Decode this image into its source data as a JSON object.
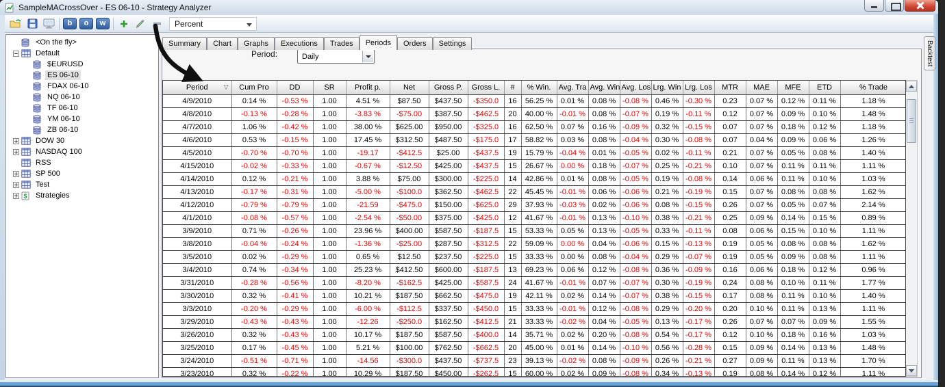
{
  "window": {
    "title": "SampleMACrossOver - ES 06-10 - Strategy Analyzer"
  },
  "toolbar": {
    "letter_buttons": [
      "b",
      "o",
      "w"
    ],
    "display_mode": "Percent"
  },
  "sidebar": {
    "items": [
      {
        "label": "<On the fly>",
        "level": 0,
        "expander": null,
        "icon": "database",
        "selected": false
      },
      {
        "label": "Default",
        "level": 0,
        "expander": "minus",
        "icon": "instrument-list",
        "selected": false
      },
      {
        "label": "$EURUSD",
        "level": 1,
        "expander": null,
        "icon": "database",
        "selected": false
      },
      {
        "label": "ES 06-10",
        "level": 1,
        "expander": null,
        "icon": "database",
        "selected": true
      },
      {
        "label": "FDAX 06-10",
        "level": 1,
        "expander": null,
        "icon": "database",
        "selected": false
      },
      {
        "label": "NQ 06-10",
        "level": 1,
        "expander": null,
        "icon": "database",
        "selected": false
      },
      {
        "label": "TF 06-10",
        "level": 1,
        "expander": null,
        "icon": "database",
        "selected": false
      },
      {
        "label": "YM 06-10",
        "level": 1,
        "expander": null,
        "icon": "database",
        "selected": false
      },
      {
        "label": "ZB 06-10",
        "level": 1,
        "expander": null,
        "icon": "database",
        "selected": false
      },
      {
        "label": "DOW 30",
        "level": 0,
        "expander": "plus",
        "icon": "instrument-list",
        "selected": false
      },
      {
        "label": "NASDAQ 100",
        "level": 0,
        "expander": "plus",
        "icon": "instrument-list",
        "selected": false
      },
      {
        "label": "RSS",
        "level": 0,
        "expander": null,
        "icon": "instrument-list",
        "selected": false
      },
      {
        "label": "SP 500",
        "level": 0,
        "expander": "plus",
        "icon": "instrument-list",
        "selected": false
      },
      {
        "label": "Test",
        "level": 0,
        "expander": "plus",
        "icon": "instrument-list",
        "selected": false
      },
      {
        "label": "Strategies",
        "level": 0,
        "expander": "plus",
        "icon": "strategies",
        "selected": false
      }
    ]
  },
  "tabs": {
    "items": [
      "Summary",
      "Chart",
      "Graphs",
      "Executions",
      "Trades",
      "Periods",
      "Orders",
      "Settings"
    ],
    "active": "Periods"
  },
  "period_selector": {
    "label": "Period:",
    "value": "Daily"
  },
  "side_tab": "Backtest",
  "icons": {
    "sort_glyph": "▽",
    "strategies_glyph": "$"
  },
  "grid": {
    "columns": [
      "Period",
      "Cum Pro",
      "DD",
      "SR",
      "Profit p.",
      "Net",
      "Gross P.",
      "Gross L.",
      "#",
      "% Win.",
      "Avg. Tra",
      "Avg. Win",
      "Avg. Los",
      "Lrg. Win",
      "Lrg. Los",
      "MTR",
      "MAE",
      "MFE",
      "ETD",
      "% Trade"
    ],
    "sort": {
      "column": "Period",
      "direction": "desc"
    },
    "red_cells": [
      [
        5,
        10
      ],
      [
        11,
        10
      ]
    ],
    "rows": [
      [
        "4/9/2010",
        "0.14 %",
        "-0.53 %",
        "1.00",
        "4.51 %",
        "$87.50",
        "$437.50",
        "-$350.0",
        "16",
        "56.25 %",
        "0.01 %",
        "0.08 %",
        "-0.08 %",
        "0.46 %",
        "-0.30 %",
        "0.23",
        "0.07 %",
        "0.12 %",
        "0.11 %",
        "1.18 %"
      ],
      [
        "4/8/2010",
        "-0.13 %",
        "-0.28 %",
        "1.00",
        "-3.83 %",
        "-$75.00",
        "$387.50",
        "-$462.5",
        "20",
        "40.00 %",
        "-0.01 %",
        "0.08 %",
        "-0.07 %",
        "0.19 %",
        "-0.11 %",
        "0.12",
        "0.07 %",
        "0.09 %",
        "0.10 %",
        "1.48 %"
      ],
      [
        "4/7/2010",
        "1.06 %",
        "-0.42 %",
        "1.00",
        "38.00 %",
        "$625.00",
        "$950.00",
        "-$325.0",
        "16",
        "62.50 %",
        "0.07 %",
        "0.16 %",
        "-0.09 %",
        "0.32 %",
        "-0.15 %",
        "0.07",
        "0.07 %",
        "0.18 %",
        "0.12 %",
        "1.18 %"
      ],
      [
        "4/6/2010",
        "0.53 %",
        "-0.15 %",
        "1.00",
        "17.45 %",
        "$312.50",
        "$487.50",
        "-$175.0",
        "17",
        "58.82 %",
        "0.03 %",
        "0.08 %",
        "-0.04 %",
        "0.30 %",
        "-0.08 %",
        "0.07",
        "0.04 %",
        "0.09 %",
        "0.06 %",
        "1.26 %"
      ],
      [
        "4/5/2010",
        "-0.70 %",
        "-0.70 %",
        "1.00",
        "-19.17",
        "-$412.5",
        "$25.00",
        "-$437.5",
        "19",
        "15.79 %",
        "-0.04 %",
        "0.01 %",
        "-0.05 %",
        "0.02 %",
        "-0.11 %",
        "0.21",
        "0.07 %",
        "0.05 %",
        "0.08 %",
        "1.40 %"
      ],
      [
        "4/15/2010",
        "-0.02 %",
        "-0.33 %",
        "1.00",
        "-0.67 %",
        "-$12.50",
        "$425.00",
        "-$437.5",
        "15",
        "26.67 %",
        "0.00 %",
        "0.18 %",
        "-0.07 %",
        "0.25 %",
        "-0.21 %",
        "0.10",
        "0.07 %",
        "0.11 %",
        "0.11 %",
        "1.11 %"
      ],
      [
        "4/14/2010",
        "0.12 %",
        "-0.21 %",
        "1.00",
        "3.88 %",
        "$75.00",
        "$300.00",
        "-$225.0",
        "14",
        "42.86 %",
        "0.01 %",
        "0.08 %",
        "-0.05 %",
        "0.19 %",
        "-0.08 %",
        "0.14",
        "0.06 %",
        "0.11 %",
        "0.10 %",
        "1.03 %"
      ],
      [
        "4/13/2010",
        "-0.17 %",
        "-0.31 %",
        "1.00",
        "-5.00 %",
        "-$100.0",
        "$362.50",
        "-$462.5",
        "22",
        "45.45 %",
        "-0.01 %",
        "0.06 %",
        "-0.06 %",
        "0.21 %",
        "-0.19 %",
        "0.15",
        "0.07 %",
        "0.08 %",
        "0.08 %",
        "1.62 %"
      ],
      [
        "4/12/2010",
        "-0.79 %",
        "-0.79 %",
        "1.00",
        "-21.59",
        "-$475.0",
        "$150.00",
        "-$625.0",
        "29",
        "37.93 %",
        "-0.03 %",
        "0.02 %",
        "-0.06 %",
        "0.08 %",
        "-0.15 %",
        "0.26",
        "0.07 %",
        "0.05 %",
        "0.07 %",
        "2.14 %"
      ],
      [
        "4/1/2010",
        "-0.08 %",
        "-0.57 %",
        "1.00",
        "-2.54 %",
        "-$50.00",
        "$375.00",
        "-$425.0",
        "12",
        "41.67 %",
        "-0.01 %",
        "0.13 %",
        "-0.10 %",
        "0.38 %",
        "-0.21 %",
        "0.25",
        "0.09 %",
        "0.14 %",
        "0.15 %",
        "0.89 %"
      ],
      [
        "3/9/2010",
        "0.71 %",
        "-0.26 %",
        "1.00",
        "23.96 %",
        "$400.00",
        "$587.50",
        "-$187.5",
        "15",
        "53.33 %",
        "0.05 %",
        "0.13 %",
        "-0.05 %",
        "0.33 %",
        "-0.11 %",
        "0.08",
        "0.06 %",
        "0.15 %",
        "0.10 %",
        "1.11 %"
      ],
      [
        "3/8/2010",
        "-0.04 %",
        "-0.24 %",
        "1.00",
        "-1.36 %",
        "-$25.00",
        "$287.50",
        "-$312.5",
        "22",
        "59.09 %",
        "0.00 %",
        "0.04 %",
        "-0.06 %",
        "0.15 %",
        "-0.13 %",
        "0.19",
        "0.05 %",
        "0.08 %",
        "0.08 %",
        "1.62 %"
      ],
      [
        "3/5/2010",
        "0.02 %",
        "-0.29 %",
        "1.00",
        "0.65 %",
        "$12.50",
        "$237.50",
        "-$225.0",
        "15",
        "33.33 %",
        "0.00 %",
        "0.08 %",
        "-0.04 %",
        "0.29 %",
        "-0.07 %",
        "0.19",
        "0.05 %",
        "0.09 %",
        "0.08 %",
        "1.11 %"
      ],
      [
        "3/4/2010",
        "0.74 %",
        "-0.34 %",
        "1.00",
        "25.23 %",
        "$412.50",
        "$600.00",
        "-$187.5",
        "13",
        "69.23 %",
        "0.06 %",
        "0.12 %",
        "-0.08 %",
        "0.36 %",
        "-0.09 %",
        "0.16",
        "0.06 %",
        "0.18 %",
        "0.12 %",
        "0.96 %"
      ],
      [
        "3/31/2010",
        "-0.28 %",
        "-0.56 %",
        "1.00",
        "-8.20 %",
        "-$162.5",
        "$425.00",
        "-$587.5",
        "24",
        "41.67 %",
        "-0.01 %",
        "0.07 %",
        "-0.07 %",
        "0.30 %",
        "-0.19 %",
        "0.24",
        "0.08 %",
        "0.10 %",
        "0.11 %",
        "1.77 %"
      ],
      [
        "3/30/2010",
        "0.32 %",
        "-0.41 %",
        "1.00",
        "10.21 %",
        "$187.50",
        "$662.50",
        "-$475.0",
        "19",
        "42.11 %",
        "0.02 %",
        "0.14 %",
        "-0.07 %",
        "0.38 %",
        "-0.15 %",
        "0.17",
        "0.08 %",
        "0.11 %",
        "0.10 %",
        "1.40 %"
      ],
      [
        "3/3/2010",
        "-0.20 %",
        "-0.29 %",
        "1.00",
        "-6.00 %",
        "-$112.5",
        "$337.50",
        "-$450.0",
        "15",
        "33.33 %",
        "-0.01 %",
        "0.12 %",
        "-0.08 %",
        "0.29 %",
        "-0.20 %",
        "0.20",
        "0.10 %",
        "0.11 %",
        "0.13 %",
        "1.11 %"
      ],
      [
        "3/29/2010",
        "-0.43 %",
        "-0.43 %",
        "1.00",
        "-12.26",
        "-$250.0",
        "$162.50",
        "-$412.5",
        "21",
        "33.33 %",
        "-0.02 %",
        "0.04 %",
        "-0.05 %",
        "0.13 %",
        "-0.17 %",
        "0.26",
        "0.07 %",
        "0.07 %",
        "0.09 %",
        "1.55 %"
      ],
      [
        "3/26/2010",
        "0.32 %",
        "-0.43 %",
        "1.00",
        "10.17 %",
        "$187.50",
        "$587.50",
        "-$400.0",
        "14",
        "35.71 %",
        "0.02 %",
        "0.20 %",
        "-0.08 %",
        "0.54 %",
        "-0.17 %",
        "0.12",
        "0.10 %",
        "0.18 %",
        "0.16 %",
        "1.03 %"
      ],
      [
        "3/25/2010",
        "0.17 %",
        "-0.45 %",
        "1.00",
        "5.21 %",
        "$100.00",
        "$762.50",
        "-$662.5",
        "20",
        "45.00 %",
        "0.01 %",
        "0.14 %",
        "-0.10 %",
        "0.56 %",
        "-0.28 %",
        "0.15",
        "0.09 %",
        "0.14 %",
        "0.13 %",
        "1.48 %"
      ],
      [
        "3/24/2010",
        "-0.51 %",
        "-0.71 %",
        "1.00",
        "-14.56",
        "-$300.0",
        "$437.50",
        "-$737.5",
        "23",
        "39.13 %",
        "-0.02 %",
        "0.08 %",
        "-0.09 %",
        "0.26 %",
        "-0.21 %",
        "0.27",
        "0.09 %",
        "0.11 %",
        "0.13 %",
        "1.70 %"
      ],
      [
        "3/23/2010",
        "0.32 %",
        "-0.22 %",
        "1.00",
        "10.29 %",
        "$187.50",
        "$450.00",
        "-$262.5",
        "15",
        "60.00 %",
        "0.02 %",
        "0.09 %",
        "-0.08 %",
        "0.34 %",
        "-0.13 %",
        "0.19",
        "0.08 %",
        "0.14 %",
        "0.12 %",
        "1.11 %"
      ]
    ]
  }
}
